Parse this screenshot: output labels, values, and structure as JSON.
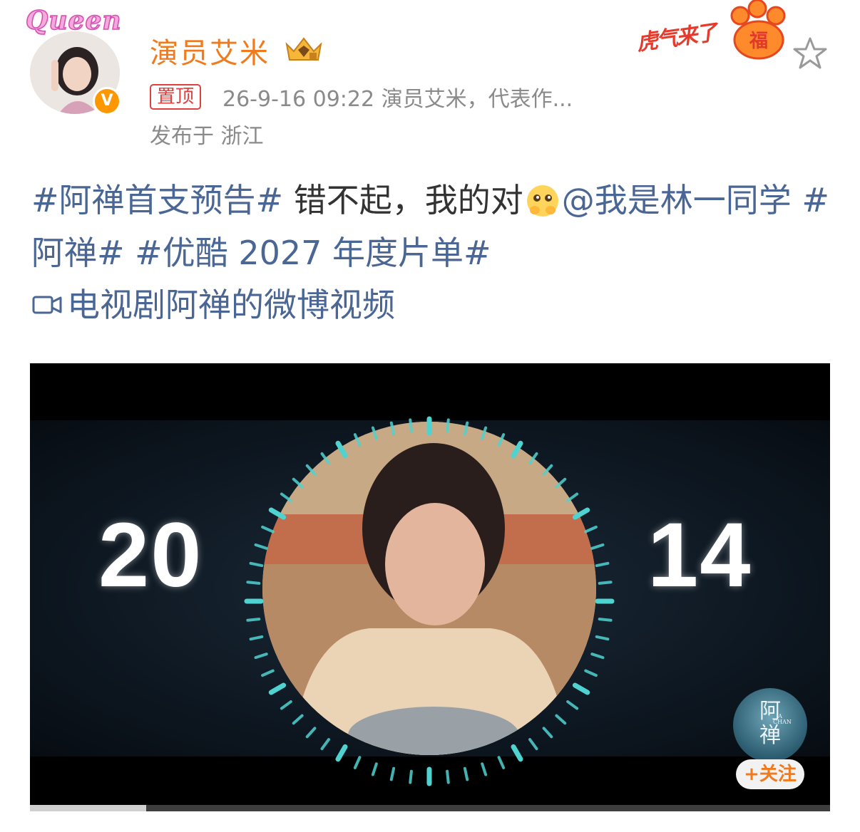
{
  "header": {
    "badge": "Queen",
    "user_name": "演员艾米",
    "verified_mark": "V",
    "pinned_label": "置顶",
    "meta": "26-9-16 09:22  演员艾米，代表作...",
    "location": "发布于 浙江",
    "sticker_text": "虎气来了",
    "sticker_fu": "福"
  },
  "post": {
    "tag1": "#阿禅首支预告#",
    "text1": " 错不起，我的对",
    "mention": "@我是林一同学",
    "tag2": " #阿禅#",
    "tag3": " #优酷 2027 年度片单#",
    "video_link": "电视剧阿禅的微博视频"
  },
  "video": {
    "year_left": "20",
    "year_right": "14",
    "logo_text": "阿\n禅",
    "logo_sub": "A CHAN",
    "follow_label": "+关注",
    "progress_fraction": 0.145
  },
  "colors": {
    "accent_orange": "#f07a1c",
    "tag_blue": "#4a6694",
    "pinned_red": "#e0403e",
    "dial_cyan": "#4fd3d0"
  },
  "icons": [
    "verified-icon",
    "vip-crown-icon",
    "fu-paw-icon",
    "star-icon",
    "video-link-icon",
    "hug-emoji"
  ]
}
